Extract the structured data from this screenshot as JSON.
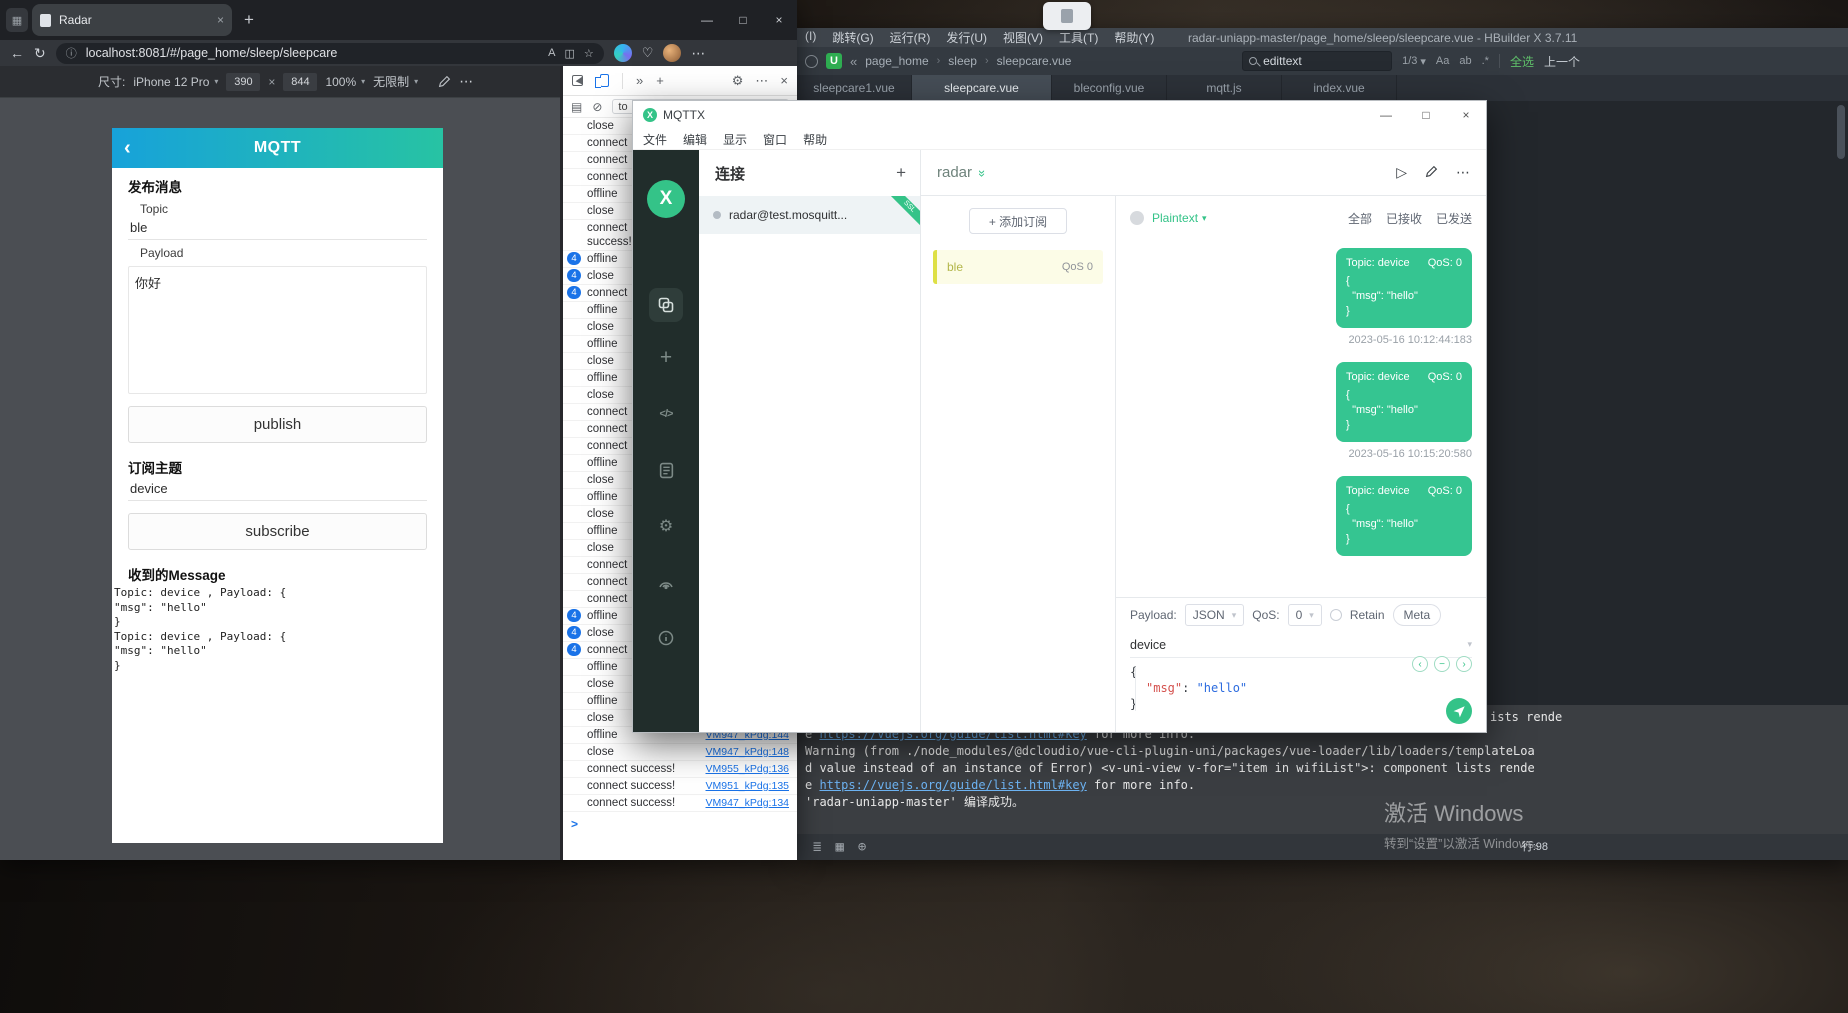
{
  "glyphs": {
    "back": "←",
    "refresh": "↻",
    "info": "ⓘ",
    "read_aloud": "A",
    "split": "◫",
    "star": "☆",
    "heart": "♡",
    "more": "⋯",
    "more_tabs": "»",
    "minimize": "—",
    "maximize": "□",
    "close": "×",
    "plus": "+",
    "caret": "▾",
    "settings": "⚙",
    "clear": "⊘",
    "sidebar": "▤",
    "prompt": ">",
    "multiply": "×",
    "collapse": "«",
    "play": "▷",
    "back_chevron": "‹",
    "chevron_left": "‹",
    "chevron_right": "›",
    "minus": "−",
    "double_chevron": "»",
    "crumb_sep": "›",
    "code": "</>",
    "list_icon": "≣",
    "grid_icon": "▦",
    "globe_icon": "⊕",
    "case_icon": "Aa",
    "word_icon": "ab",
    "regex_icon": ".*",
    "u_badge": "U",
    "x_mark": "X"
  },
  "browser": {
    "tab_title": "Radar",
    "url": "localhost:8081/#/page_home/sleep/sleepcare",
    "device_toolbar": {
      "label": "尺寸:",
      "device": "iPhone 12 Pro",
      "width": "390",
      "height": "844",
      "zoom": "100%",
      "throttling": "无限制"
    },
    "page": {
      "title": "MQTT",
      "publish_title": "发布消息",
      "topic_label": "Topic",
      "topic_value": "ble",
      "payload_label": "Payload",
      "payload_value": "你好",
      "publish_button": "publish",
      "subscribe_title": "订阅主题",
      "subscribe_topic_value": "device",
      "subscribe_button": "subscribe",
      "received_title": "收到的Message",
      "received_lines": [
        "Topic: device , Payload: {",
        "\"msg\": \"hello\"",
        "}",
        "Topic: device , Payload: {",
        "\"msg\": \"hello\"",
        "}"
      ]
    },
    "devtools": {
      "filter_value": "to",
      "entries": [
        {
          "text": "close"
        },
        {
          "text": "connect"
        },
        {
          "text": "connect"
        },
        {
          "text": "connect"
        },
        {
          "text": "offline"
        },
        {
          "text": "close"
        },
        {
          "text": "connect\nsuccess!"
        },
        {
          "text": "offline",
          "count": "4"
        },
        {
          "text": "close",
          "count": "4"
        },
        {
          "text": "connect",
          "count": "4"
        },
        {
          "text": "offline"
        },
        {
          "text": "close"
        },
        {
          "text": "offline"
        },
        {
          "text": "close"
        },
        {
          "text": "offline"
        },
        {
          "text": "close"
        },
        {
          "text": "connect"
        },
        {
          "text": "connect"
        },
        {
          "text": "connect"
        },
        {
          "text": "offline"
        },
        {
          "text": "close"
        },
        {
          "text": "offline"
        },
        {
          "text": "close"
        },
        {
          "text": "offline"
        },
        {
          "text": "close"
        },
        {
          "text": "connect"
        },
        {
          "text": "connect"
        },
        {
          "text": "connect"
        },
        {
          "text": "offline",
          "count": "4"
        },
        {
          "text": "close",
          "count": "4"
        },
        {
          "text": "connect",
          "count": "4"
        },
        {
          "text": "offline"
        },
        {
          "text": "close"
        },
        {
          "text": "offline"
        },
        {
          "text": "close"
        },
        {
          "text": "offline",
          "link": "VM947_kPdg:144"
        },
        {
          "text": "close",
          "link": "VM947_kPdg:148"
        },
        {
          "text": "connect success!",
          "link": "VM955_kPdg:136"
        },
        {
          "text": "connect success!",
          "link": "VM951_kPdg:135"
        },
        {
          "text": "connect success!",
          "link": "VM947_kPdg:134"
        }
      ]
    }
  },
  "mqttx": {
    "title": "MQTTX",
    "menu": [
      "文件",
      "编辑",
      "显示",
      "窗口",
      "帮助"
    ],
    "connections_header": "连接",
    "connection_name": "radar@test.mosquitt...",
    "ssl_label": "SSL",
    "connection_title": "radar",
    "add_subscription": "+ 添加订阅",
    "subscription_topic": "ble",
    "subscription_qos": "QoS 0",
    "format": "Plaintext",
    "filter_tabs": [
      "全部",
      "已接收",
      "已发送"
    ],
    "messages": [
      {
        "topic": "Topic: device",
        "qos": "QoS: 0",
        "body": "{\n  \"msg\": \"hello\"\n}",
        "timestamp": "2023-05-16 10:12:44:183"
      },
      {
        "topic": "Topic: device",
        "qos": "QoS: 0",
        "body": "{\n  \"msg\": \"hello\"\n}",
        "timestamp": "2023-05-16 10:15:20:580"
      },
      {
        "topic": "Topic: device",
        "qos": "QoS: 0",
        "body": "{\n  \"msg\": \"hello\"\n}",
        "timestamp": ""
      }
    ],
    "compose": {
      "payload_label": "Payload:",
      "payload_format": "JSON",
      "qos_label": "QoS:",
      "qos_value": "0",
      "retain_label": "Retain",
      "meta_label": "Meta",
      "topic_value": "device",
      "editor": {
        "line1": "{",
        "key": "\"msg\"",
        "colon": ": ",
        "value": "\"hello\"",
        "line3": "}"
      }
    }
  },
  "hbuilder": {
    "menu": [
      "(I)",
      "跳转(G)",
      "运行(R)",
      "发行(U)",
      "视图(V)",
      "工具(T)",
      "帮助(Y)"
    ],
    "window_title": "radar-uniapp-master/page_home/sleep/sleepcare.vue - HBuilder X 3.7.11",
    "breadcrumb": [
      "page_home",
      "sleep",
      "sleepcare.vue"
    ],
    "find": {
      "query": "edittext",
      "counter": "1/3",
      "select_all": "全选",
      "prev": "上一个"
    },
    "tabs": [
      "sleepcare1.vue",
      "sleepcare.vue",
      "bleconfig.vue",
      "mqtt.js",
      "index.vue"
    ],
    "console_fragment": "ists rende",
    "console_lines": [
      {
        "pre": "e ",
        "link": "https://vuejs.org/guide/list.html#key",
        "post": " for more info."
      },
      {
        "pre": "Warning (from ./node_modules/@dcloudio/vue-cli-plugin-uni/packages/vue-loader/lib/loaders/templateLoa",
        "link": "",
        "post": ""
      },
      {
        "pre": "d value instead of an instance of Error) <v-uni-view v-for=\"item in wifiList\">: component lists rende",
        "link": "",
        "post": ""
      },
      {
        "pre": "e ",
        "link": "https://vuejs.org/guide/list.html#key",
        "post": " for more info."
      },
      {
        "pre": "'radar-uniapp-master' 编译成功。",
        "link": "",
        "post": ""
      }
    ],
    "status_line": "行:98"
  },
  "watermark": {
    "line1": "激活 Windows",
    "line2": "转到“设置”以激活 Windows。"
  }
}
